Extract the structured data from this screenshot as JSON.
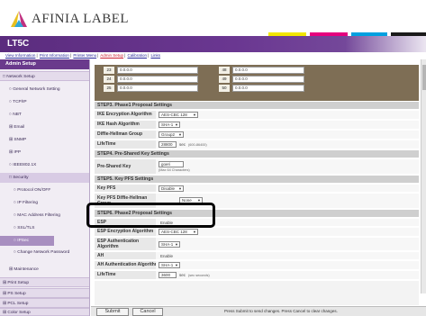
{
  "brand": {
    "logo_text": "AFINIA LABEL",
    "mark_color_1": "#e8c020",
    "mark_color_2": "#c03080",
    "mark_color_3": "#30a8d8"
  },
  "color_bars": [
    "#f2e600",
    "#e6007e",
    "#00a0e0",
    "#1a1a1a"
  ],
  "window_title": "LT5C",
  "links": [
    "View Information",
    "Print Information",
    "Printer Menu",
    "Admin Setup",
    "Calibration",
    "Links"
  ],
  "sidebar": [
    {
      "label": "Admin Setup"
    },
    {
      "label": "□ Network Setup"
    },
    {
      "label": "○ General Network Setting"
    },
    {
      "label": "○ TCP/IP"
    },
    {
      "label": "○ NBT"
    },
    {
      "label": "⊞ Email"
    },
    {
      "label": "⊞ SNMP"
    },
    {
      "label": "⊞ IPP"
    },
    {
      "label": "○ IEEE802.1X"
    },
    {
      "label": "□ Security"
    },
    {
      "label": "○ Protocol ON/OFF"
    },
    {
      "label": "○ IP Filtering"
    },
    {
      "label": "○ MAC Address Filtering"
    },
    {
      "label": "○ SSL/TLS"
    },
    {
      "label": "○ IPSec"
    },
    {
      "label": "○ Change Network Password"
    },
    {
      "label": "⊞ Maintenance"
    },
    {
      "label": "⊞ Print Setup"
    },
    {
      "label": "⊞ PS Setup"
    },
    {
      "label": "⊞ PCL Setup"
    },
    {
      "label": "⊞ Color Setup"
    }
  ],
  "address_table": {
    "rows": [
      {
        "n1": "23",
        "ip1": "0.0.0.0",
        "n2": "48",
        "ip2": "0.0.0.0"
      },
      {
        "n1": "24",
        "ip1": "0.0.0.0",
        "n2": "49",
        "ip2": "0.0.0.0"
      },
      {
        "n1": "25",
        "ip1": "0.0.0.0",
        "n2": "50",
        "ip2": "0.0.0.0"
      }
    ]
  },
  "settings": {
    "step3_title": "STEP3. Phase1 Proposal Settings",
    "ike_enc_label": "IKE Encryption Algorithm",
    "ike_enc_value": "AES-CBC 128",
    "ike_hash_label": "IKE Hash Algorithm",
    "ike_hash_value": "SHA-1",
    "dh_group_label": "Diffie-Hellman Group",
    "dh_group_value": "Group2",
    "lifetime1_label": "LifeTime",
    "lifetime1_value": "28800",
    "lifetime1_unit": "sec",
    "lifetime1_note": "(600-86400)",
    "step4_title": "STEP4. Pre-Shared Key Settings",
    "psk_label": "Pre-Shared Key",
    "psk_value": "goeri",
    "psk_note": "(Max 64 Characters)",
    "step5_title": "STEP5. Key PFS Settings",
    "key_pfs_label": "Key PFS",
    "key_pfs_value": "Disable",
    "key_pfs_dh_label": "Key PFS Diffie-Hellman Group",
    "key_pfs_dh_value": "None",
    "step6_title": "STEP6. Phase2 Proposal Settings",
    "esp_label": "ESP",
    "esp_value": "Enable",
    "esp_enc_label": "ESP Encryption Algorithm",
    "esp_enc_value": "AES-CBC 128",
    "esp_auth_label": "ESP Authentication Algorithm",
    "esp_auth_value": "SHA-1",
    "ah_label": "AH",
    "ah_value": "Enable",
    "ah_auth_label": "AH Authentication Algorithm",
    "ah_auth_value": "SHA-1",
    "lifetime2_label": "LifeTime",
    "lifetime2_value": "3600",
    "lifetime2_unit": "sec",
    "lifetime2_note": "(sec seconds)"
  },
  "bottom": {
    "submit_label": "Submit",
    "cancel_label": "Cancel",
    "message": "Press Submit to send changes. Press Cancel to clear changes."
  },
  "accent_colors": {
    "title_bar": "#5b2c7e",
    "sidebar_header": "#6a3a8c",
    "highlight": "#000000"
  }
}
